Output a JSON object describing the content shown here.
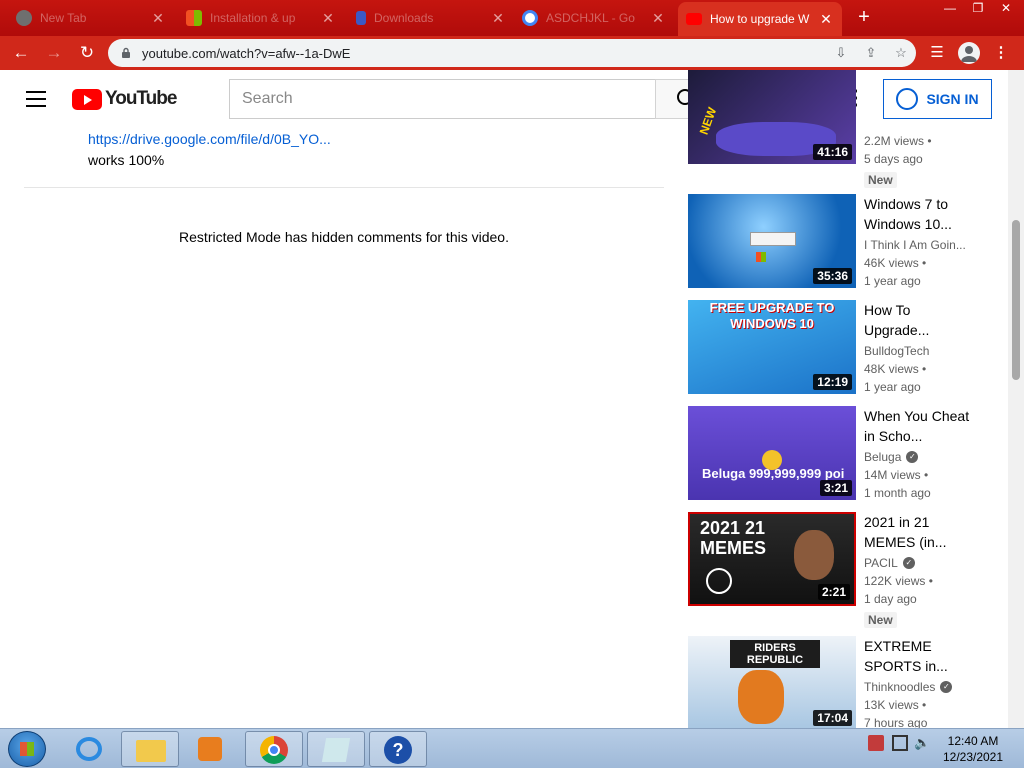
{
  "browser": {
    "tabs": [
      {
        "title": "New Tab",
        "favicon_color": "#888888"
      },
      {
        "title": "Installation & up",
        "favicon_color": "#f25022"
      },
      {
        "title": "Downloads",
        "favicon_color": "#3c59c4"
      },
      {
        "title": "ASDCHJKL - Go",
        "favicon_color": "#ffffff"
      },
      {
        "title": "How to upgrade W",
        "favicon_color": "#ff0000"
      }
    ],
    "new_tab_label": "+",
    "url": "youtube.com/watch?v=afw--1a-DwE"
  },
  "yt_header": {
    "logo_text": "YouTube",
    "search_placeholder": "Search",
    "signin_label": "SIGN IN"
  },
  "comment": {
    "link": "https://drive.google.com/file/d/0B_YO...",
    "text": "works 100%"
  },
  "restricted_message": "Restricted Mode has hidden comments for this video.",
  "recommendations": [
    {
      "title": "",
      "channel": "",
      "verified": false,
      "views": "2.2M views •",
      "ago": "5 days ago",
      "duration": "41:16",
      "badge": "New",
      "thumb_overlay": "NEW",
      "thumb_colors": [
        "#1d1b3a",
        "#5b3fa8"
      ]
    },
    {
      "title": "Windows 7 to Windows 10...",
      "channel": "I Think I Am Goin...",
      "verified": false,
      "views": "46K views •",
      "ago": "1 year ago",
      "duration": "35:36",
      "badge": "",
      "thumb_overlay": "",
      "thumb_colors": [
        "#0c5fb0",
        "#4aa6e8"
      ]
    },
    {
      "title": "How To Upgrade...",
      "channel": "BulldogTech",
      "verified": false,
      "views": "48K views •",
      "ago": "1 year ago",
      "duration": "12:19",
      "badge": "",
      "thumb_overlay": "FREE UPGRADE TO WINDOWS 10",
      "thumb_colors": [
        "#1b8ad8",
        "#43b3f0"
      ]
    },
    {
      "title": "When You Cheat in Scho...",
      "channel": "Beluga",
      "verified": true,
      "views": "14M views •",
      "ago": "1 month ago",
      "duration": "3:21",
      "badge": "",
      "thumb_overlay": "Beluga 999,999,999 poi",
      "thumb_colors": [
        "#5b3fc4",
        "#7a5ae0"
      ]
    },
    {
      "title": "2021 in 21 MEMES (in...",
      "channel": "PACIL",
      "verified": true,
      "views": "122K views •",
      "ago": "1 day ago",
      "duration": "2:21",
      "badge": "New",
      "thumb_overlay": "2021 21 MEMES",
      "thumb_colors": [
        "#1a1a1a",
        "#3a3a3a"
      ]
    },
    {
      "title": "EXTREME SPORTS in...",
      "channel": "Thinknoodles",
      "verified": true,
      "views": "13K views •",
      "ago": "7 hours ago",
      "duration": "17:04",
      "badge": "",
      "thumb_overlay": "RIDERS REPUBLIC",
      "thumb_colors": [
        "#e2e8ef",
        "#8fb4d6"
      ]
    }
  ],
  "taskbar": {
    "time": "12:40 AM",
    "date": "12/23/2021"
  }
}
